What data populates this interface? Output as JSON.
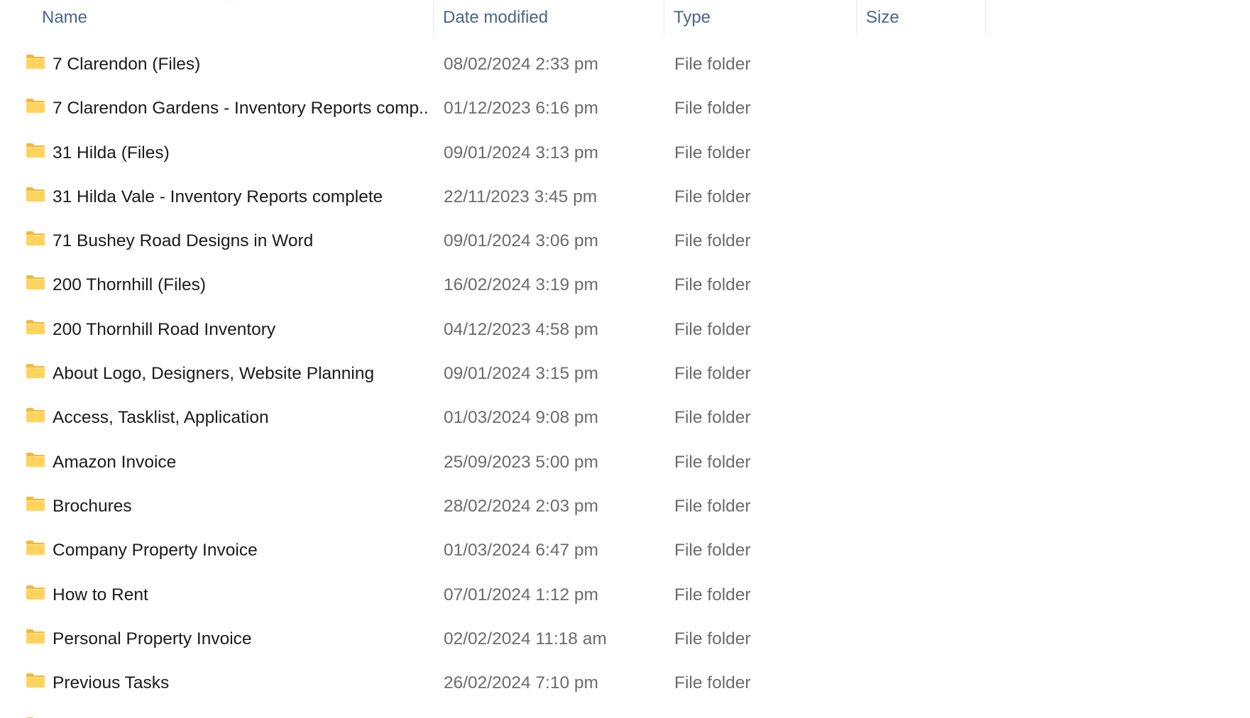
{
  "columns": {
    "name": "Name",
    "date_modified": "Date modified",
    "type": "Type",
    "size": "Size"
  },
  "icons": {
    "sort": "chevron-up-icon",
    "folder": "folder-icon"
  },
  "colors": {
    "folder_body": "#FFD35C",
    "folder_tab": "#F2B93B",
    "header_text": "#4B6584",
    "secondary_text": "#6B6B6B"
  },
  "rows": [
    {
      "name": "7 Clarendon (Files)",
      "date": "08/02/2024 2:33 pm",
      "type": "File folder",
      "size": ""
    },
    {
      "name": "7 Clarendon Gardens - Inventory Reports comp...",
      "date": "01/12/2023 6:16 pm",
      "type": "File folder",
      "size": ""
    },
    {
      "name": "31 Hilda (Files)",
      "date": "09/01/2024 3:13 pm",
      "type": "File folder",
      "size": ""
    },
    {
      "name": "31 Hilda Vale - Inventory Reports complete",
      "date": "22/11/2023 3:45 pm",
      "type": "File folder",
      "size": ""
    },
    {
      "name": "71 Bushey Road Designs in Word",
      "date": "09/01/2024 3:06 pm",
      "type": "File folder",
      "size": ""
    },
    {
      "name": "200 Thornhill (Files)",
      "date": "16/02/2024 3:19 pm",
      "type": "File folder",
      "size": ""
    },
    {
      "name": "200 Thornhill Road Inventory",
      "date": "04/12/2023 4:58 pm",
      "type": "File folder",
      "size": ""
    },
    {
      "name": "About Logo, Designers, Website Planning",
      "date": "09/01/2024 3:15 pm",
      "type": "File folder",
      "size": ""
    },
    {
      "name": "Access, Tasklist, Application",
      "date": "01/03/2024 9:08 pm",
      "type": "File folder",
      "size": ""
    },
    {
      "name": "Amazon Invoice",
      "date": "25/09/2023 5:00 pm",
      "type": "File folder",
      "size": ""
    },
    {
      "name": "Brochures",
      "date": "28/02/2024 2:03 pm",
      "type": "File folder",
      "size": ""
    },
    {
      "name": "Company Property Invoice",
      "date": "01/03/2024 6:47 pm",
      "type": "File folder",
      "size": ""
    },
    {
      "name": "How to Rent",
      "date": "07/01/2024 1:12 pm",
      "type": "File folder",
      "size": ""
    },
    {
      "name": "Personal Property Invoice",
      "date": "02/02/2024 11:18 am",
      "type": "File folder",
      "size": ""
    },
    {
      "name": "Previous Tasks",
      "date": "26/02/2024 7:10 pm",
      "type": "File folder",
      "size": ""
    },
    {
      "name": "",
      "date": "",
      "type": "",
      "size": ""
    }
  ]
}
